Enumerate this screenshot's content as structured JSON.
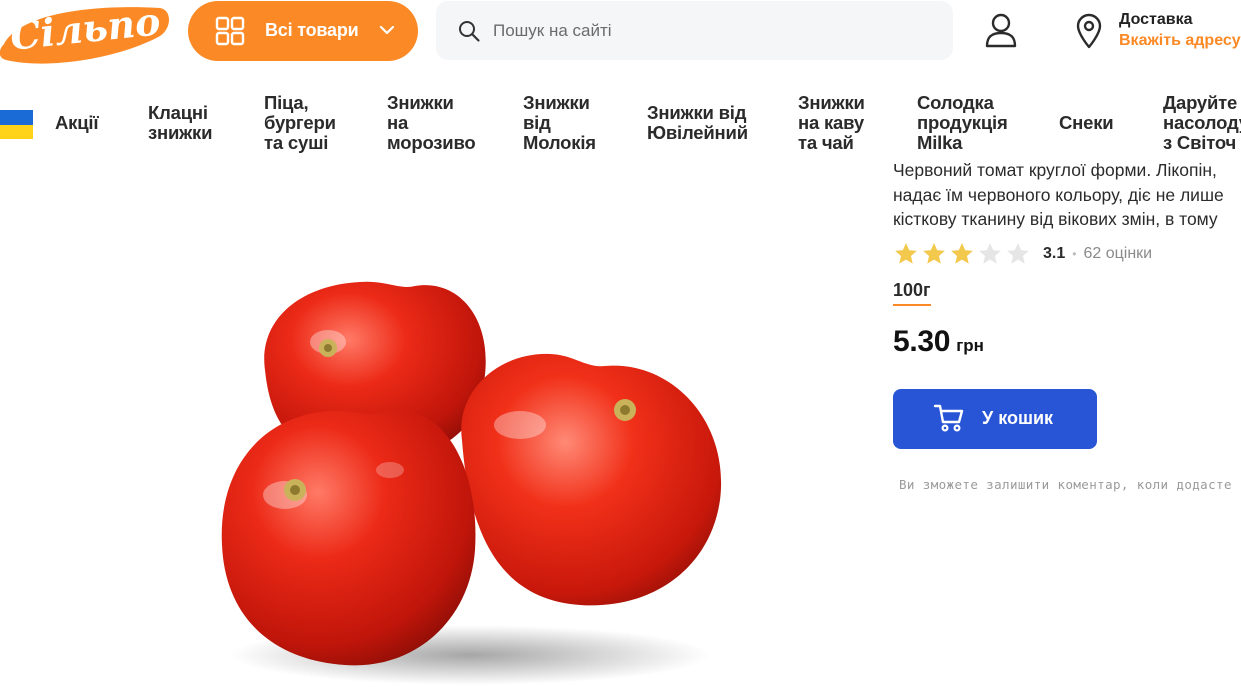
{
  "header": {
    "logo_text": "Сільпо",
    "catalog_button_label": "Всі товари",
    "search_placeholder": "Пошук на сайті",
    "delivery_title": "Доставка",
    "delivery_link": "Вкажіть адресу",
    "colors": {
      "brand_orange": "#fb8a26",
      "primary_blue": "#2855d6"
    }
  },
  "nav": {
    "items": [
      {
        "lines": [
          "Акції"
        ]
      },
      {
        "lines": [
          "Клацні",
          "знижки"
        ]
      },
      {
        "lines": [
          "Піца,",
          "бургери",
          "та суші"
        ]
      },
      {
        "lines": [
          "Знижки",
          "на",
          "морозиво"
        ]
      },
      {
        "lines": [
          "Знижки",
          "від",
          "Молокія"
        ]
      },
      {
        "lines": [
          "Знижки від",
          "Ювілейний"
        ]
      },
      {
        "lines": [
          "Знижки",
          "на каву",
          "та чай"
        ]
      },
      {
        "lines": [
          "Солодка",
          "продукція",
          "Milka"
        ]
      },
      {
        "lines": [
          "Снеки"
        ]
      },
      {
        "lines": [
          "Даруйте",
          "насолоду",
          "з Світоч"
        ]
      }
    ]
  },
  "product": {
    "description_lines": [
      "Червоний томат круглої форми. Лікопін,",
      "надає їм червоного кольору, діє не лише",
      "кісткову тканину від вікових змін, в тому"
    ],
    "rating": {
      "value": "3.1",
      "stars_filled": 3,
      "stars_total": 5,
      "count_text": "62 оцінки"
    },
    "weight": "100г",
    "price": "5.30",
    "currency": "грн",
    "cart_button_label": "У кошик",
    "comment_note": "Ви зможете залишити коментар, коли додасте"
  }
}
